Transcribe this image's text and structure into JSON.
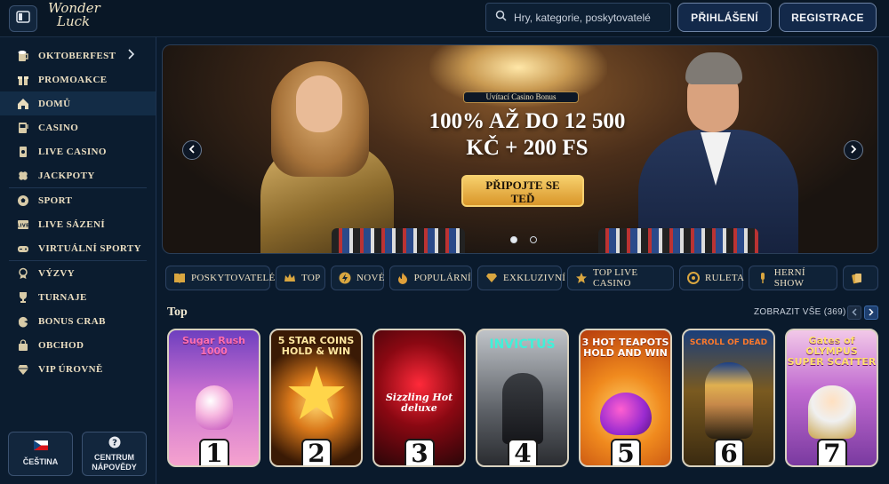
{
  "header": {
    "logo_line1": "Wonder",
    "logo_line2": "Luck",
    "search_placeholder": "Hry, kategorie, poskytovatelé",
    "login_label": "PŘIHLÁŠENÍ",
    "register_label": "REGISTRACE"
  },
  "sidebar": {
    "items": [
      {
        "label": "OKTOBERFEST",
        "icon": "beer-mug-icon"
      },
      {
        "label": "PROMOAKCE",
        "icon": "gift-icon"
      },
      {
        "label": "DOMŮ",
        "icon": "home-icon"
      },
      {
        "label": "CASINO",
        "icon": "slot-machine-icon"
      },
      {
        "label": "LIVE CASINO",
        "icon": "cards-icon"
      },
      {
        "label": "JACKPOTY",
        "icon": "clover-icon"
      },
      {
        "label": "SPORT",
        "icon": "soccer-ball-icon"
      },
      {
        "label": "LIVE SÁZENÍ",
        "icon": "live-icon"
      },
      {
        "label": "VIRTUÁLNÍ SPORTY",
        "icon": "gamepad-icon"
      },
      {
        "label": "VÝZVY",
        "icon": "badge-icon"
      },
      {
        "label": "TURNAJE",
        "icon": "trophy-icon"
      },
      {
        "label": "BONUS CRAB",
        "icon": "crab-claw-icon"
      },
      {
        "label": "OBCHOD",
        "icon": "shop-bag-icon"
      },
      {
        "label": "VIP ÚROVNĚ",
        "icon": "diamond-icon"
      }
    ],
    "language_label": "ČEŠTINA",
    "help_label_1": "CENTRUM",
    "help_label_2": "NÁPOVĚDY"
  },
  "banner": {
    "badge": "Uvítací Casino Bonus",
    "line1": "100% AŽ DO 12 500",
    "line2": "KČ + 200 FS",
    "cta_line1": "PŘIPOJTE SE",
    "cta_line2": "TEĎ",
    "slides": 2,
    "active_slide": 1
  },
  "categories": [
    {
      "label": "POSKYTOVATELÉ",
      "icon": "book-icon"
    },
    {
      "label": "TOP",
      "icon": "crown-icon"
    },
    {
      "label": "NOVÉ",
      "icon": "lightning-icon"
    },
    {
      "label": "POPULÁRNÍ",
      "icon": "flame-icon"
    },
    {
      "label": "EXKLUZIVNÍ",
      "icon": "gem-icon"
    },
    {
      "label": "TOP LIVE CASINO",
      "icon": "star-icon"
    },
    {
      "label": "RULETA",
      "icon": "roulette-icon"
    },
    {
      "label": "HERNÍ SHOW",
      "icon": "microphone-icon"
    },
    {
      "label": "",
      "icon": "cards-icon"
    }
  ],
  "top_section": {
    "title": "Top",
    "see_all": "ZOBRAZIT VŠE (369)",
    "games": [
      {
        "rank": "1",
        "title": "Sugar Rush 1000"
      },
      {
        "rank": "2",
        "title": "5 STAR COINS HOLD & WIN"
      },
      {
        "rank": "3",
        "title": "Sizzling Hot deluxe"
      },
      {
        "rank": "4",
        "title": "INVICTUS"
      },
      {
        "rank": "5",
        "title": "3 HOT TEAPOTS HOLD AND WIN"
      },
      {
        "rank": "6",
        "title": "SCROLL OF DEAD"
      },
      {
        "rank": "7",
        "title": "Gates of OLYMPUS SUPER SCATTER"
      }
    ]
  },
  "colors": {
    "background": "#0a1a2c",
    "accent_gold": "#e0a93a",
    "text": "#ecdfc2"
  }
}
